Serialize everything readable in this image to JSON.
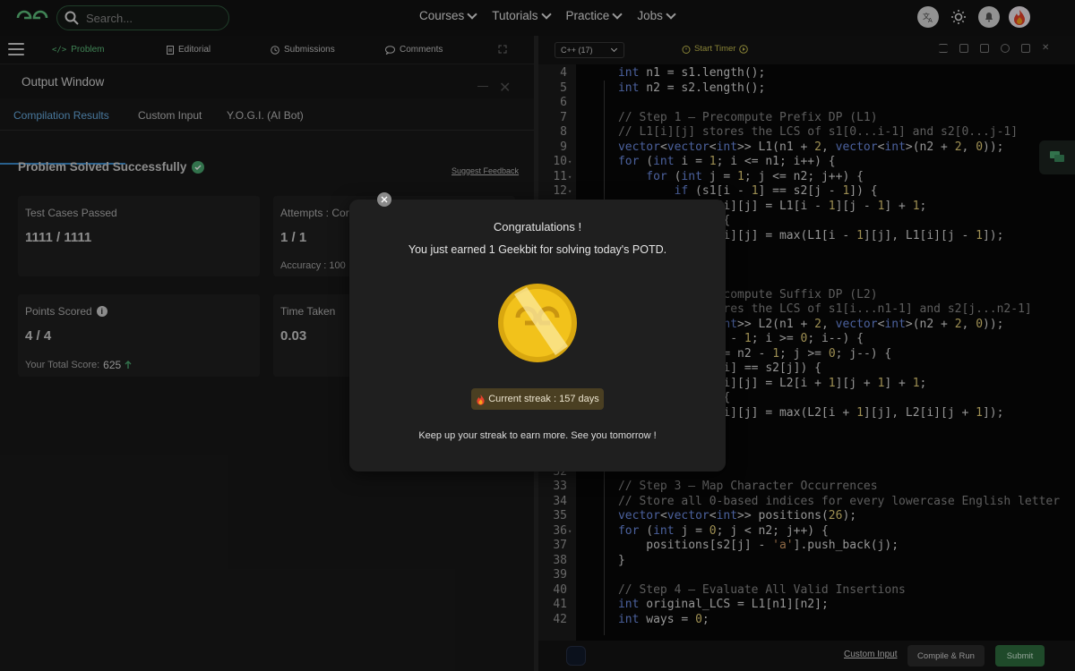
{
  "nav": {
    "search_placeholder": "Search...",
    "menu": [
      "Courses",
      "Tutorials",
      "Practice",
      "Jobs"
    ]
  },
  "left_tabs": [
    "Problem",
    "Editorial",
    "Submissions",
    "Comments"
  ],
  "output": {
    "title": "Output Window",
    "tabs": [
      "Compilation Results",
      "Custom Input",
      "Y.O.G.I. (AI Bot)"
    ],
    "status": "Problem Solved Successfully",
    "feedback": "Suggest Feedback",
    "cards": {
      "tests_label": "Test Cases Passed",
      "tests_value": "1111 / 1111",
      "attempts_label": "Attempts : Corr",
      "attempts_value": "1 / 1",
      "accuracy": "Accuracy : 100",
      "points_label": "Points Scored",
      "points_value": "4 / 4",
      "total_label": "Your Total Score:",
      "total_value": "625",
      "time_label": "Time Taken",
      "time_value": "0.03"
    }
  },
  "editor": {
    "language": "C++ (17)",
    "timer": "Start Timer",
    "lines": [
      {
        "n": "4",
        "fold": false,
        "code": "    int n1 = s1.length();"
      },
      {
        "n": "5",
        "fold": false,
        "code": "    int n2 = s2.length();"
      },
      {
        "n": "6",
        "fold": false,
        "code": ""
      },
      {
        "n": "7",
        "fold": false,
        "code": "    // Step 1 — Precompute Prefix DP (L1)"
      },
      {
        "n": "8",
        "fold": false,
        "code": "    // L1[i][j] stores the LCS of s1[0...i-1] and s2[0...j-1]"
      },
      {
        "n": "9",
        "fold": false,
        "code": "    vector<vector<int>> L1(n1 + 2, vector<int>(n2 + 2, 0));"
      },
      {
        "n": "10",
        "fold": true,
        "code": "    for (int i = 1; i <= n1; i++) {"
      },
      {
        "n": "11",
        "fold": true,
        "code": "        for (int j = 1; j <= n2; j++) {"
      },
      {
        "n": "12",
        "fold": true,
        "code": "            if (s1[i - 1] == s2[j - 1]) {"
      },
      {
        "n": "",
        "fold": false,
        "code": "                L1[i][j] = L1[i - 1][j - 1] + 1;"
      },
      {
        "n": "",
        "fold": false,
        "code": "            } else {"
      },
      {
        "n": "",
        "fold": false,
        "code": "                L1[i][j] = max(L1[i - 1][j], L1[i][j - 1]);"
      },
      {
        "n": "",
        "fold": false,
        "code": ""
      },
      {
        "n": "",
        "fold": false,
        "code": ""
      },
      {
        "n": "",
        "fold": false,
        "code": ""
      },
      {
        "n": "",
        "fold": false,
        "code": "    // Step 2 — Precompute Suffix DP (L2)"
      },
      {
        "n": "",
        "fold": false,
        "code": "    // L2[i][j] stores the LCS of s1[i...n1-1] and s2[j...n2-1]"
      },
      {
        "n": "",
        "fold": false,
        "code": "    vector<vector<int>> L2(n1 + 2, vector<int>(n2 + 2, 0));"
      },
      {
        "n": "",
        "fold": false,
        "code": "    for (int i = n1 - 1; i >= 0; i--) {"
      },
      {
        "n": "",
        "fold": false,
        "code": "        for (int j = n2 - 1; j >= 0; j--) {"
      },
      {
        "n": "",
        "fold": false,
        "code": "            if (s1[i] == s2[j]) {"
      },
      {
        "n": "",
        "fold": false,
        "code": "                L2[i][j] = L2[i + 1][j + 1] + 1;"
      },
      {
        "n": "",
        "fold": false,
        "code": "            } else {"
      },
      {
        "n": "",
        "fold": false,
        "code": "                L2[i][j] = max(L2[i + 1][j], L2[i][j + 1]);"
      },
      {
        "n": "",
        "fold": false,
        "code": ""
      },
      {
        "n": "",
        "fold": false,
        "code": ""
      },
      {
        "n": "",
        "fold": false,
        "code": "    }"
      },
      {
        "n": "32",
        "fold": false,
        "code": ""
      },
      {
        "n": "33",
        "fold": false,
        "code": "    // Step 3 — Map Character Occurrences"
      },
      {
        "n": "34",
        "fold": false,
        "code": "    // Store all 0-based indices for every lowercase English letter"
      },
      {
        "n": "35",
        "fold": false,
        "code": "    vector<vector<int>> positions(26);"
      },
      {
        "n": "36",
        "fold": true,
        "code": "    for (int j = 0; j < n2; j++) {"
      },
      {
        "n": "37",
        "fold": false,
        "code": "        positions[s2[j] - 'a'].push_back(j);"
      },
      {
        "n": "38",
        "fold": false,
        "code": "    }"
      },
      {
        "n": "39",
        "fold": false,
        "code": ""
      },
      {
        "n": "40",
        "fold": false,
        "code": "    // Step 4 — Evaluate All Valid Insertions"
      },
      {
        "n": "41",
        "fold": false,
        "code": "    int original_LCS = L1[n1][n2];"
      },
      {
        "n": "42",
        "fold": false,
        "code": "    int ways = 0;"
      }
    ]
  },
  "bottom": {
    "custom_input": "Custom Input",
    "compile": "Compile & Run",
    "submit": "Submit"
  },
  "modal": {
    "title": "Congratulations !",
    "text": "You just earned 1 Geekbit for solving today's POTD.",
    "streak": "Current streak : 157 days",
    "footer": "Keep up your streak to earn more. See you tomorrow !"
  },
  "colors": {
    "accent_green": "#5fc27e",
    "accent_blue": "#3d8fd1",
    "submit_bg": "#2e6d3f",
    "coin": "#f2c21b"
  }
}
